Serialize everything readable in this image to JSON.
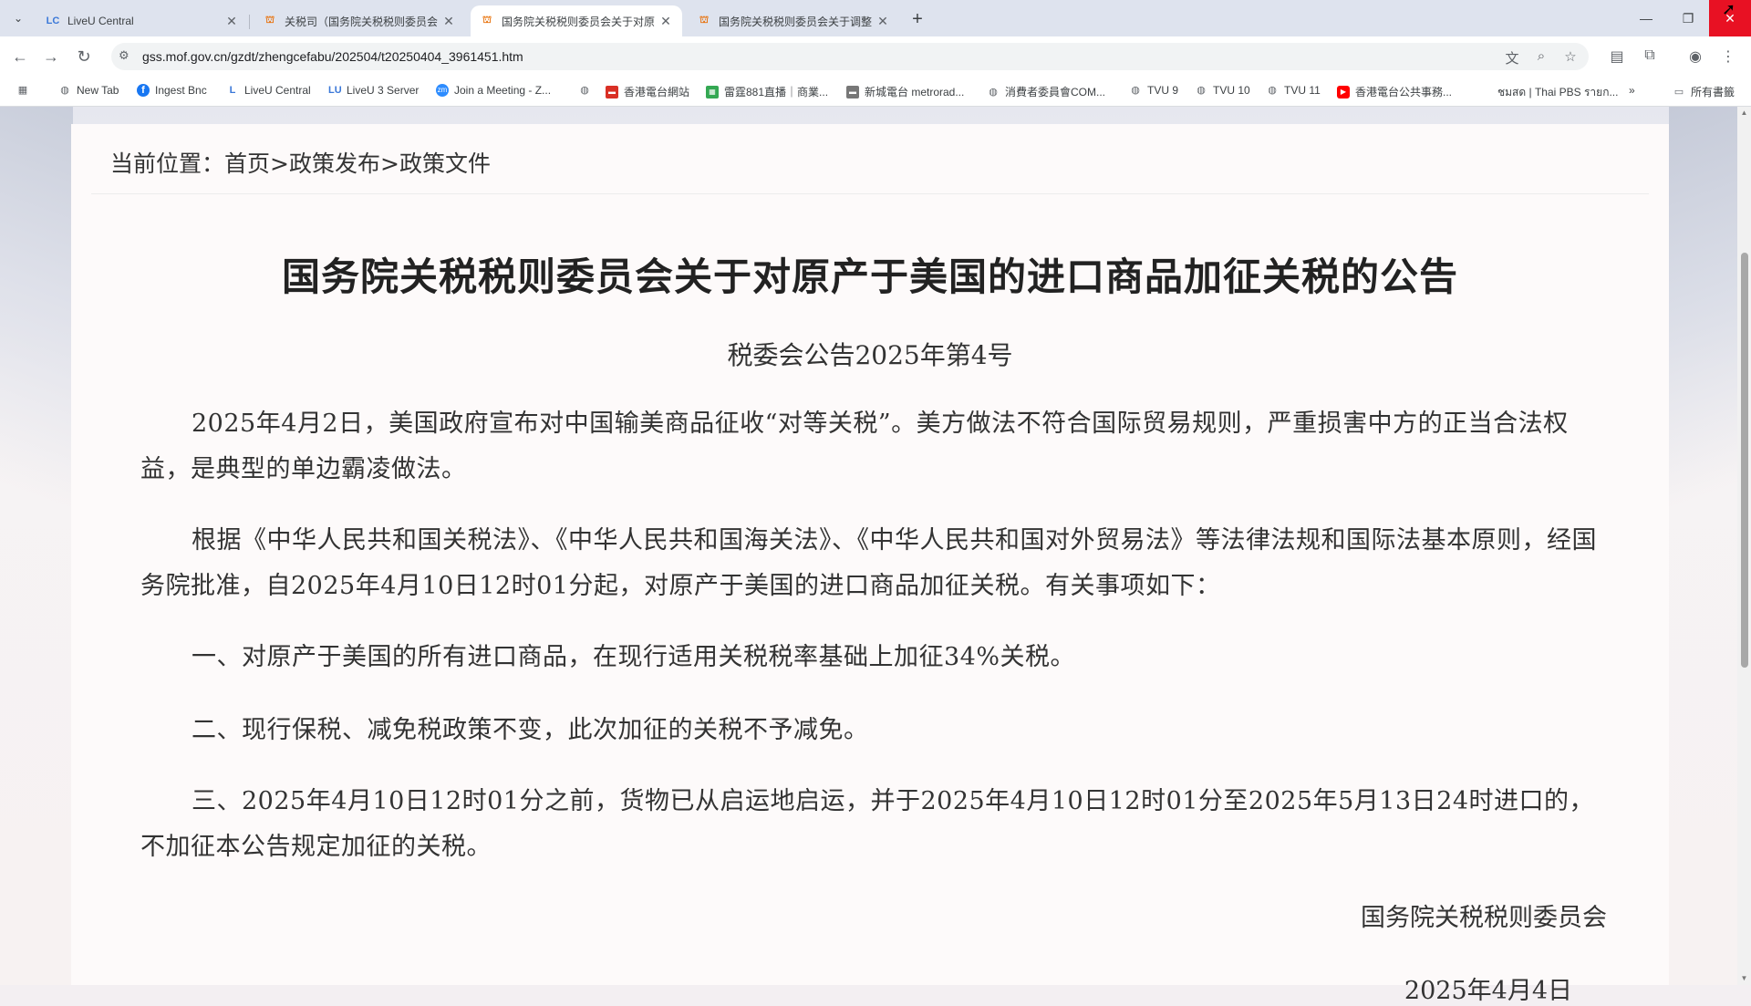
{
  "browser": {
    "tabs": [
      {
        "title": "LiveU Central",
        "favicon": "liveu-icon",
        "active": false
      },
      {
        "title": "关税司（国务院关税税则委员会",
        "favicon": "gov-emblem-icon",
        "active": false
      },
      {
        "title": "国务院关税税则委员会关于对原",
        "favicon": "gov-emblem-icon",
        "active": true
      },
      {
        "title": "国务院关税税则委员会关于调整",
        "favicon": "gov-emblem-icon",
        "active": false
      }
    ],
    "url": "gss.mof.gov.cn/gzdt/zhengcefabu/202504/t20250404_3961451.htm",
    "bookmarks": [
      {
        "label": "New Tab",
        "icon": "globe-icon"
      },
      {
        "label": "Ingest Bnc",
        "icon": "facebook-icon"
      },
      {
        "label": "LiveU Central",
        "icon": "liveu-icon"
      },
      {
        "label": "LiveU 3 Server",
        "icon": "liveu-icon"
      },
      {
        "label": "Join a Meeting - Z...",
        "icon": "zoom-icon"
      },
      {
        "label": "",
        "icon": "globe-icon"
      },
      {
        "label": "香港電台網站",
        "icon": "rthk-icon"
      },
      {
        "label": "雷霆881直播｜商業...",
        "icon": "radio-icon"
      },
      {
        "label": "新城電台 metrorad...",
        "icon": "metro-icon"
      },
      {
        "label": "消費者委員會COM...",
        "icon": "globe-icon"
      },
      {
        "label": "TVU 9",
        "icon": "globe-icon"
      },
      {
        "label": "TVU 10",
        "icon": "globe-icon"
      },
      {
        "label": "TVU 11",
        "icon": "globe-icon"
      },
      {
        "label": "香港電台公共事務...",
        "icon": "youtube-icon"
      },
      {
        "label": "ชมสด | Thai PBS รายก...",
        "icon": "globe-icon"
      }
    ],
    "overflow_label": "»",
    "all_bookmarks_label": "所有書籤"
  },
  "page": {
    "breadcrumb": {
      "prefix": "当前位置：",
      "items": [
        "首页",
        "政策发布",
        "政策文件"
      ],
      "separator": ">"
    },
    "title": "国务院关税税则委员会关于对原产于美国的进口商品加征关税的公告",
    "doc_number": "税委会公告2025年第4号",
    "paragraphs": [
      "2025年4月2日，美国政府宣布对中国输美商品征收“对等关税”。美方做法不符合国际贸易规则，严重损害中方的正当合法权益，是典型的单边霸凌做法。",
      "根据《中华人民共和国关税法》、《中华人民共和国海关法》、《中华人民共和国对外贸易法》等法律法规和国际法基本原则，经国务院批准，自2025年4月10日12时01分起，对原产于美国的进口商品加征关税。有关事项如下：",
      "一、对原产于美国的所有进口商品，在现行适用关税税率基础上加征34%关税。",
      "二、现行保税、减免税政策不变，此次加征的关税不予减免。",
      "三、2025年4月10日12时01分之前，货物已从启运地启运，并于2025年4月10日12时01分至2025年5月13日24时进口的，不加征本公告规定加征的关税。"
    ],
    "signature": "国务院关税税则委员会",
    "date": "2025年4月4日"
  }
}
